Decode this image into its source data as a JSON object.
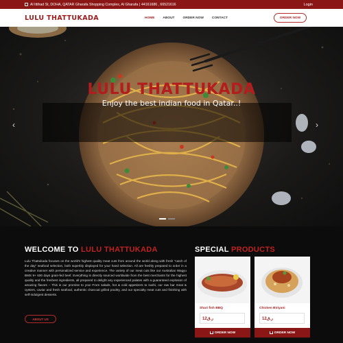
{
  "topbar": {
    "address": "Al Ittihad St, DOHA, QATAR Gharafa Shopping Complex, Al Gharafa | ",
    "phone": "44161686 , 66521616",
    "login": "Login"
  },
  "navbar": {
    "brand": "LULU THATTUKADA",
    "items": [
      "HOME",
      "ABOUT",
      "ORDER NOW",
      "CONTACT"
    ],
    "active_index": 0,
    "order_button": "ORDER NOW"
  },
  "hero": {
    "title": "LULU THATTUKADA",
    "subtitle": "Enjoy the best indian food in Qatar..!",
    "prev_arrow": "‹",
    "next_arrow": "›",
    "slide_count": 2,
    "active_slide": 1
  },
  "welcome": {
    "heading_prefix": "WELCOME TO ",
    "heading_highlight": "LULU THATTUKADA",
    "body": "Lulu Thattukada focuses on the world's highest quality meat cuts from around the world along with fresh \"catch of the day\" seafood selection, both superbly displayed for your hand selection. All are freshly prepared to order in a creative manner with personalized service and experience. The variety of our meat cuts like our Australian Wagyu BMS 9+ 600 days grain-fed beef. Everything is directly sourced worldwide from the best merchants for the highest quality and the freshest ingredients, all prepared to delight any experienced palates with a guaranteed explosion of amazing flavors – This is our promise to you! From salads, hot & cold appetizers to sushi, our raw bar meat & oysters, caviar and fresh seafood, authentic charcoal grilled poultry, and our specialty meat cuts and finishing with self-indulgent desserts.",
    "button": "ABOUT US"
  },
  "special": {
    "heading_prefix": "SPECIAL ",
    "heading_highlight": "PRODUCTS",
    "products": [
      {
        "name": "Shari fish BBQ",
        "price": "12ر.ق",
        "button": "ORDER NOW"
      },
      {
        "name": "Chicken Biriyani",
        "price": "12ر.ق",
        "button": "ORDER NOW"
      }
    ]
  },
  "colors": {
    "brand_red": "#8b1616",
    "accent_red": "#c0221f"
  }
}
